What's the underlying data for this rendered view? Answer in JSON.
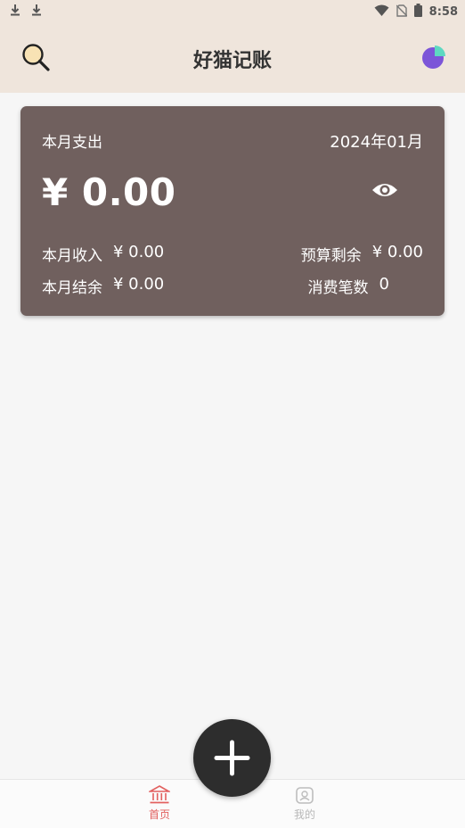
{
  "status_bar": {
    "time": "8:58",
    "icons_left": [
      "download-icon",
      "download-icon"
    ],
    "icons_right": [
      "wifi-icon",
      "no-sim-icon",
      "battery-icon"
    ]
  },
  "header": {
    "title": "好猫记账",
    "left_icon": "search-icon",
    "right_icon": "pie-chart-icon"
  },
  "summary": {
    "label": "本月支出",
    "month": "2024年01月",
    "amount": "¥ 0.00",
    "income_label": "本月收入",
    "income_value": "¥ 0.00",
    "budget_label": "预算剩余",
    "budget_value": "¥ 0.00",
    "balance_label": "本月结余",
    "balance_value": "¥ 0.00",
    "count_label": "消费笔数",
    "count_value": "0"
  },
  "bottom_nav": {
    "home_label": "首页",
    "mine_label": "我的"
  },
  "colors": {
    "header_bg": "#efe5dc",
    "card_bg": "#70605e",
    "accent": "#e2605f",
    "fab_bg": "#2d2d2d"
  }
}
